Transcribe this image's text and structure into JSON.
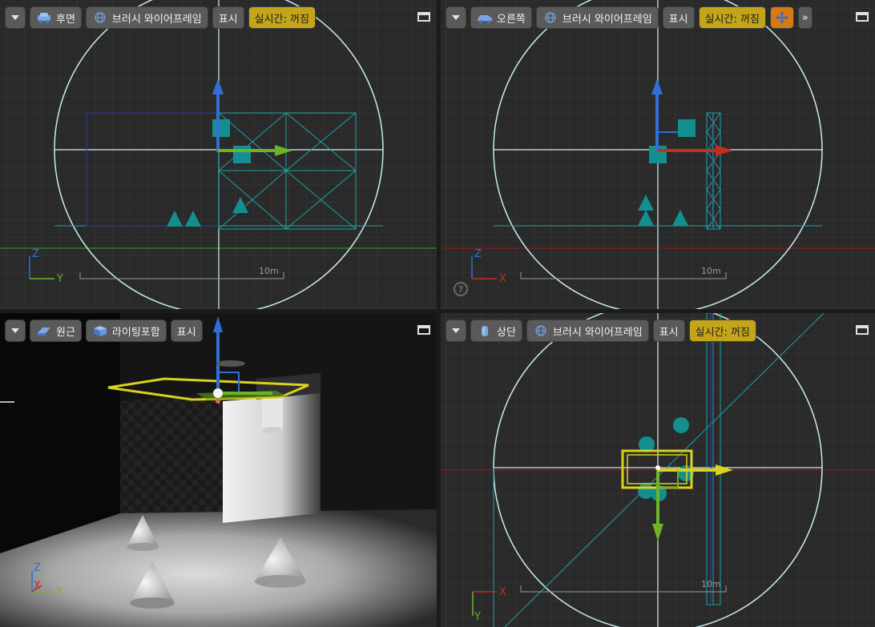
{
  "viewports": {
    "back": {
      "view_label": "후면",
      "shading_label": "브러시 와이어프레임",
      "show_label": "표시",
      "realtime_label": "실시간: 꺼짐",
      "icon": "car-icon",
      "scale_label": "10m",
      "axis_labels": [
        "Z",
        "Y"
      ]
    },
    "right": {
      "view_label": "오른쪽",
      "shading_label": "브러시 와이어프레임",
      "show_label": "표시",
      "realtime_label": "실시간: 꺼짐",
      "icon": "car-icon",
      "scale_label": "10m",
      "axis_labels": [
        "Z",
        "X"
      ],
      "more_label": "»",
      "active": true
    },
    "perspective": {
      "view_label": "원근",
      "shading_label": "라이팅포함",
      "show_label": "표시",
      "icon": "cube-icon",
      "axis_labels": [
        "Z",
        "X",
        "Y"
      ]
    },
    "top": {
      "view_label": "상단",
      "shading_label": "브러시 와이어프레임",
      "show_label": "표시",
      "realtime_label": "실시간: 꺼짐",
      "icon": "figure-icon",
      "scale_label": "10m",
      "axis_labels": [
        "X",
        "Y"
      ]
    }
  },
  "colors": {
    "grid": "#3a3a3a",
    "grid_line": "#474747",
    "circle": "#c8ecec",
    "wire": "#1fa3a3",
    "axis_z": "#2f6fd6",
    "axis_y_green": "#6db32a",
    "axis_x_red": "#c0301e",
    "select_yellow": "#d9d21e",
    "active_border": "#d8b13a"
  }
}
